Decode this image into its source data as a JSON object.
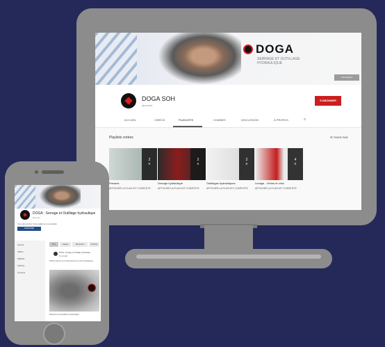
{
  "desktop": {
    "banner": {
      "logo_text": "DOGA",
      "tagline": "SERRAGE ET OUTILLAGE HYDRAULIQUE",
      "button_label": "www.doga.fr"
    },
    "channel": {
      "name": "DOGA SOH",
      "subscribers": "abonnés",
      "subscribe_label": "S'ABONNER"
    },
    "tabs": [
      {
        "label": "ACCUEIL"
      },
      {
        "label": "VIDÉOS"
      },
      {
        "label": "PLAYLISTS"
      },
      {
        "label": "CHAÎNES"
      },
      {
        "label": "DISCUSSION"
      },
      {
        "label": "À PROPOS"
      }
    ],
    "active_tab": "PLAYLISTS",
    "section_title": "Playlists créées",
    "sort_label": "TRIER PAR",
    "playlists": [
      {
        "title": "Presses",
        "count": "2",
        "link": "AFFICHER LA PLAYLIST COMPLÈTE"
      },
      {
        "title": "Serrage hydraulique",
        "count": "2",
        "link": "AFFICHER LA PLAYLIST COMPLÈTE"
      },
      {
        "title": "Outillages hydrauliques",
        "count": "2",
        "link": "AFFICHER LA PLAYLIST COMPLÈTE"
      },
      {
        "title": "Levage - Vérins et crics",
        "count": "4",
        "link": "AFFICHER LA PLAYLIST COMPLÈTE"
      }
    ]
  },
  "mobile": {
    "channel_title": "DOGA : Serrage et Outillage hydraulique",
    "subscribers": "abonnés",
    "description": "Vous découvrirez ici la qualité de nos produits",
    "subscribe_label": "S'ABONNER",
    "nav": [
      {
        "label": "Accueil"
      },
      {
        "label": "Vidéos"
      },
      {
        "label": "Playlists"
      },
      {
        "label": "Chaînes"
      },
      {
        "label": "À propos"
      }
    ],
    "tabs": [
      {
        "label": "Tous"
      },
      {
        "label": "Images"
      },
      {
        "label": "Discussion"
      },
      {
        "label": "Chaînes"
      }
    ],
    "post_author": "DOGA : Serrage et Outillage hydraulique",
    "post_time": "il y a 1 jour",
    "post_text": "DOGA présente sa nouvelle gamme de vérins hydrauliques.",
    "post_footer": "Découvrez nos produits sur www.doga.fr"
  },
  "colors": {
    "background": "#24295a",
    "device": "#8c8c8c",
    "accent_red": "#cc1e1e"
  }
}
